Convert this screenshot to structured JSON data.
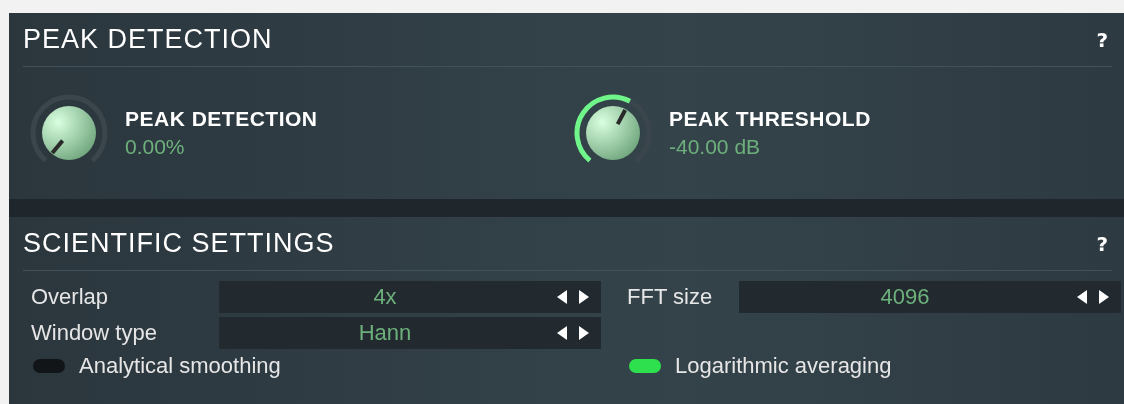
{
  "sections": [
    {
      "title": "PEAK DETECTION",
      "help": "?",
      "knobs": [
        {
          "label": "PEAK DETECTION",
          "value": "0.00%"
        },
        {
          "label": "PEAK THRESHOLD",
          "value": "-40.00 dB"
        }
      ]
    },
    {
      "title": "SCIENTIFIC SETTINGS",
      "help": "?",
      "rows": [
        [
          {
            "kind": "selector",
            "label": "Overlap",
            "value": "4x"
          },
          {
            "kind": "selector",
            "label": "FFT size",
            "value": "4096"
          }
        ],
        [
          {
            "kind": "selector",
            "label": "Window type",
            "value": "Hann"
          }
        ],
        [
          {
            "kind": "switch",
            "label": "Analytical smoothing",
            "on": false
          },
          {
            "kind": "switch",
            "label": "Logarithmic averaging",
            "on": true
          }
        ]
      ]
    }
  ]
}
